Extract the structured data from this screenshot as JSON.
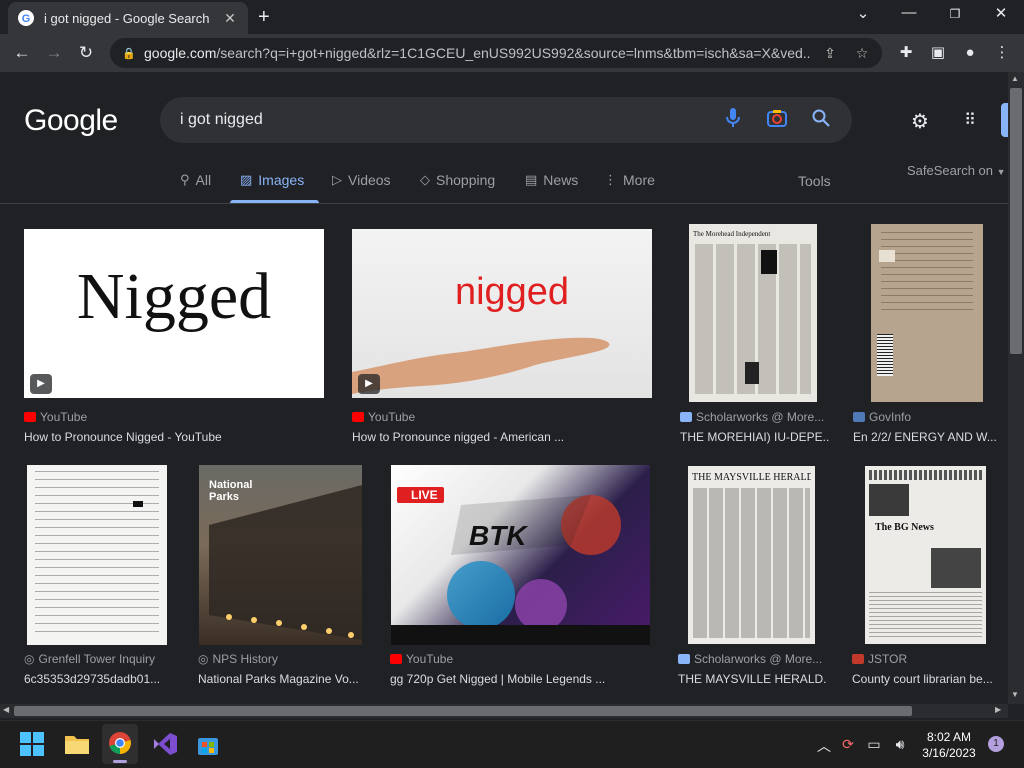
{
  "browser": {
    "tab_title": "i got nigged - Google Search",
    "url_domain": "google.com",
    "url_path": "/search?q=i+got+nigged&rlz=1C1GCEU_enUS992US992&source=lnms&tbm=isch&sa=X&ved..."
  },
  "google": {
    "logo": "Google",
    "query": "i got nigged",
    "safesearch": "SafeSearch on",
    "tools": "Tools",
    "tabs": [
      {
        "label": "All",
        "icon": "search-icon"
      },
      {
        "label": "Images",
        "icon": "image-icon"
      },
      {
        "label": "Videos",
        "icon": "video-icon"
      },
      {
        "label": "Shopping",
        "icon": "tag-icon"
      },
      {
        "label": "News",
        "icon": "news-icon"
      },
      {
        "label": "More",
        "icon": "more-vert-icon"
      }
    ]
  },
  "results": [
    {
      "thumb_text": "Nigged",
      "source": "YouTube",
      "title": "How to Pronounce Nigged - YouTube"
    },
    {
      "thumb_text": "nigged",
      "source": "YouTube",
      "title": "How to Pronounce nigged - American ..."
    },
    {
      "thumb_text": "The Morehead Independent",
      "source": "Scholarworks @ More...",
      "title": "THE MOREHIAI) IU-DEPE..."
    },
    {
      "source": "GovInfo",
      "title": "En 2/2/ ENERGY AND W..."
    },
    {
      "source": "Grenfell Tower Inquiry",
      "title": "6c35353d29735dadb01..."
    },
    {
      "thumb_text": "National Parks",
      "source": "NPS History",
      "title": "National Parks Magazine Vo..."
    },
    {
      "thumb_text": "LIVE",
      "source": "YouTube",
      "title": "gg 720p Get Nigged | Mobile Legends ..."
    },
    {
      "thumb_text": "THE MAYSVILLE HERALD.",
      "source": "Scholarworks @ More...",
      "title": "THE MAYSVILLE HERALD."
    },
    {
      "thumb_text": "The BG News",
      "source": "JSTOR",
      "title": "County court librarian be..."
    }
  ],
  "taskbar": {
    "time": "8:02 AM",
    "date": "3/16/2023",
    "notifications": "1"
  },
  "colors": {
    "accent": "#8ab4f8",
    "background": "#202124",
    "youtube": "#ff0000"
  }
}
